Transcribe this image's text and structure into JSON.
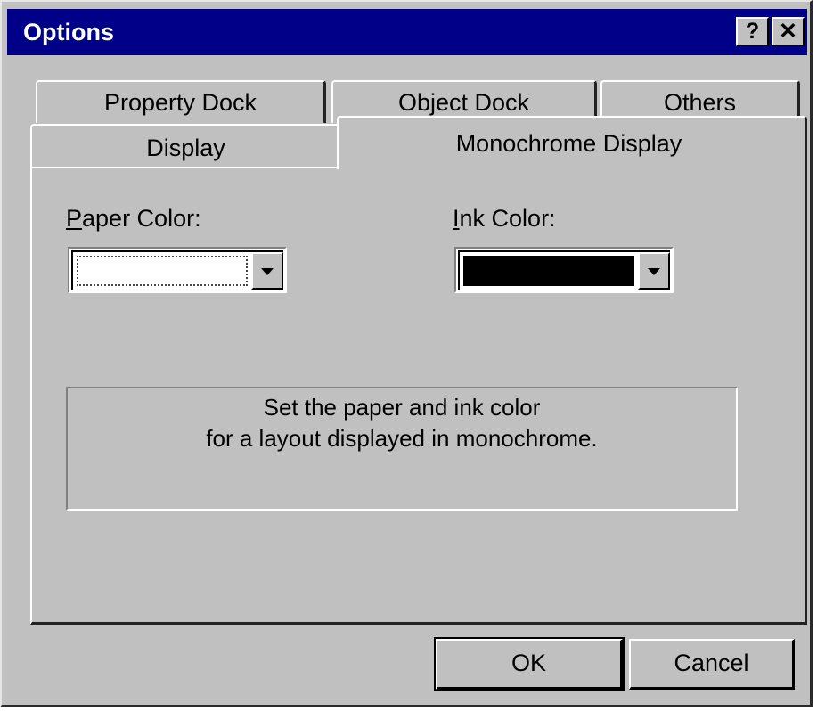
{
  "window": {
    "title": "Options",
    "help_button": "?",
    "close_button": "✕"
  },
  "tabs": {
    "row_back": [
      {
        "label": "Property Dock"
      },
      {
        "label": "Object Dock"
      },
      {
        "label": "Others"
      }
    ],
    "row_front": [
      {
        "label": "Display"
      },
      {
        "label": "Monochrome Display",
        "selected": true
      }
    ]
  },
  "monochrome": {
    "paper_color": {
      "label_underlined": "P",
      "label_rest": "aper Color:",
      "value_color": "#ffffff"
    },
    "ink_color": {
      "label_underlined": "I",
      "label_rest": "nk Color:",
      "value_color": "#000000"
    },
    "description": {
      "line1": "Set the paper and ink color",
      "line2": "for a layout displayed in monochrome."
    }
  },
  "footer": {
    "ok_label": "OK",
    "cancel_label": "Cancel"
  },
  "colors": {
    "titlebar": "#000088",
    "face": "#c0c0c0"
  }
}
